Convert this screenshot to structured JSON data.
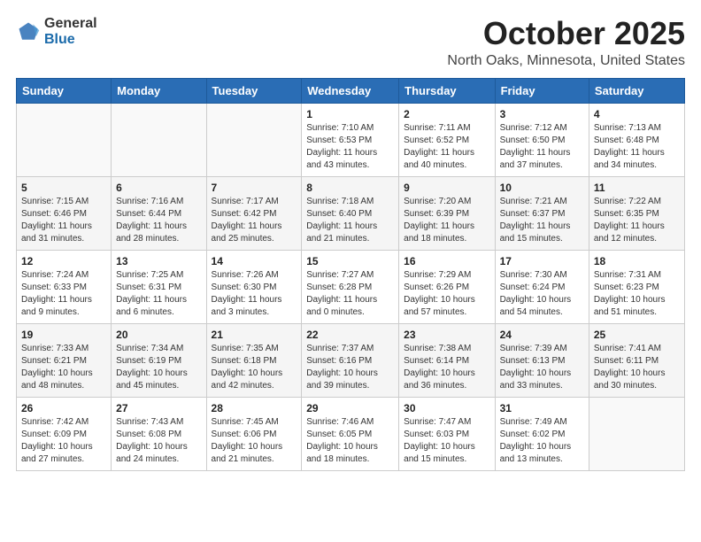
{
  "header": {
    "logo_general": "General",
    "logo_blue": "Blue",
    "month_title": "October 2025",
    "location": "North Oaks, Minnesota, United States"
  },
  "days_of_week": [
    "Sunday",
    "Monday",
    "Tuesday",
    "Wednesday",
    "Thursday",
    "Friday",
    "Saturday"
  ],
  "weeks": [
    [
      {
        "day": "",
        "info": ""
      },
      {
        "day": "",
        "info": ""
      },
      {
        "day": "",
        "info": ""
      },
      {
        "day": "1",
        "info": "Sunrise: 7:10 AM\nSunset: 6:53 PM\nDaylight: 11 hours\nand 43 minutes."
      },
      {
        "day": "2",
        "info": "Sunrise: 7:11 AM\nSunset: 6:52 PM\nDaylight: 11 hours\nand 40 minutes."
      },
      {
        "day": "3",
        "info": "Sunrise: 7:12 AM\nSunset: 6:50 PM\nDaylight: 11 hours\nand 37 minutes."
      },
      {
        "day": "4",
        "info": "Sunrise: 7:13 AM\nSunset: 6:48 PM\nDaylight: 11 hours\nand 34 minutes."
      }
    ],
    [
      {
        "day": "5",
        "info": "Sunrise: 7:15 AM\nSunset: 6:46 PM\nDaylight: 11 hours\nand 31 minutes."
      },
      {
        "day": "6",
        "info": "Sunrise: 7:16 AM\nSunset: 6:44 PM\nDaylight: 11 hours\nand 28 minutes."
      },
      {
        "day": "7",
        "info": "Sunrise: 7:17 AM\nSunset: 6:42 PM\nDaylight: 11 hours\nand 25 minutes."
      },
      {
        "day": "8",
        "info": "Sunrise: 7:18 AM\nSunset: 6:40 PM\nDaylight: 11 hours\nand 21 minutes."
      },
      {
        "day": "9",
        "info": "Sunrise: 7:20 AM\nSunset: 6:39 PM\nDaylight: 11 hours\nand 18 minutes."
      },
      {
        "day": "10",
        "info": "Sunrise: 7:21 AM\nSunset: 6:37 PM\nDaylight: 11 hours\nand 15 minutes."
      },
      {
        "day": "11",
        "info": "Sunrise: 7:22 AM\nSunset: 6:35 PM\nDaylight: 11 hours\nand 12 minutes."
      }
    ],
    [
      {
        "day": "12",
        "info": "Sunrise: 7:24 AM\nSunset: 6:33 PM\nDaylight: 11 hours\nand 9 minutes."
      },
      {
        "day": "13",
        "info": "Sunrise: 7:25 AM\nSunset: 6:31 PM\nDaylight: 11 hours\nand 6 minutes."
      },
      {
        "day": "14",
        "info": "Sunrise: 7:26 AM\nSunset: 6:30 PM\nDaylight: 11 hours\nand 3 minutes."
      },
      {
        "day": "15",
        "info": "Sunrise: 7:27 AM\nSunset: 6:28 PM\nDaylight: 11 hours\nand 0 minutes."
      },
      {
        "day": "16",
        "info": "Sunrise: 7:29 AM\nSunset: 6:26 PM\nDaylight: 10 hours\nand 57 minutes."
      },
      {
        "day": "17",
        "info": "Sunrise: 7:30 AM\nSunset: 6:24 PM\nDaylight: 10 hours\nand 54 minutes."
      },
      {
        "day": "18",
        "info": "Sunrise: 7:31 AM\nSunset: 6:23 PM\nDaylight: 10 hours\nand 51 minutes."
      }
    ],
    [
      {
        "day": "19",
        "info": "Sunrise: 7:33 AM\nSunset: 6:21 PM\nDaylight: 10 hours\nand 48 minutes."
      },
      {
        "day": "20",
        "info": "Sunrise: 7:34 AM\nSunset: 6:19 PM\nDaylight: 10 hours\nand 45 minutes."
      },
      {
        "day": "21",
        "info": "Sunrise: 7:35 AM\nSunset: 6:18 PM\nDaylight: 10 hours\nand 42 minutes."
      },
      {
        "day": "22",
        "info": "Sunrise: 7:37 AM\nSunset: 6:16 PM\nDaylight: 10 hours\nand 39 minutes."
      },
      {
        "day": "23",
        "info": "Sunrise: 7:38 AM\nSunset: 6:14 PM\nDaylight: 10 hours\nand 36 minutes."
      },
      {
        "day": "24",
        "info": "Sunrise: 7:39 AM\nSunset: 6:13 PM\nDaylight: 10 hours\nand 33 minutes."
      },
      {
        "day": "25",
        "info": "Sunrise: 7:41 AM\nSunset: 6:11 PM\nDaylight: 10 hours\nand 30 minutes."
      }
    ],
    [
      {
        "day": "26",
        "info": "Sunrise: 7:42 AM\nSunset: 6:09 PM\nDaylight: 10 hours\nand 27 minutes."
      },
      {
        "day": "27",
        "info": "Sunrise: 7:43 AM\nSunset: 6:08 PM\nDaylight: 10 hours\nand 24 minutes."
      },
      {
        "day": "28",
        "info": "Sunrise: 7:45 AM\nSunset: 6:06 PM\nDaylight: 10 hours\nand 21 minutes."
      },
      {
        "day": "29",
        "info": "Sunrise: 7:46 AM\nSunset: 6:05 PM\nDaylight: 10 hours\nand 18 minutes."
      },
      {
        "day": "30",
        "info": "Sunrise: 7:47 AM\nSunset: 6:03 PM\nDaylight: 10 hours\nand 15 minutes."
      },
      {
        "day": "31",
        "info": "Sunrise: 7:49 AM\nSunset: 6:02 PM\nDaylight: 10 hours\nand 13 minutes."
      },
      {
        "day": "",
        "info": ""
      }
    ]
  ]
}
